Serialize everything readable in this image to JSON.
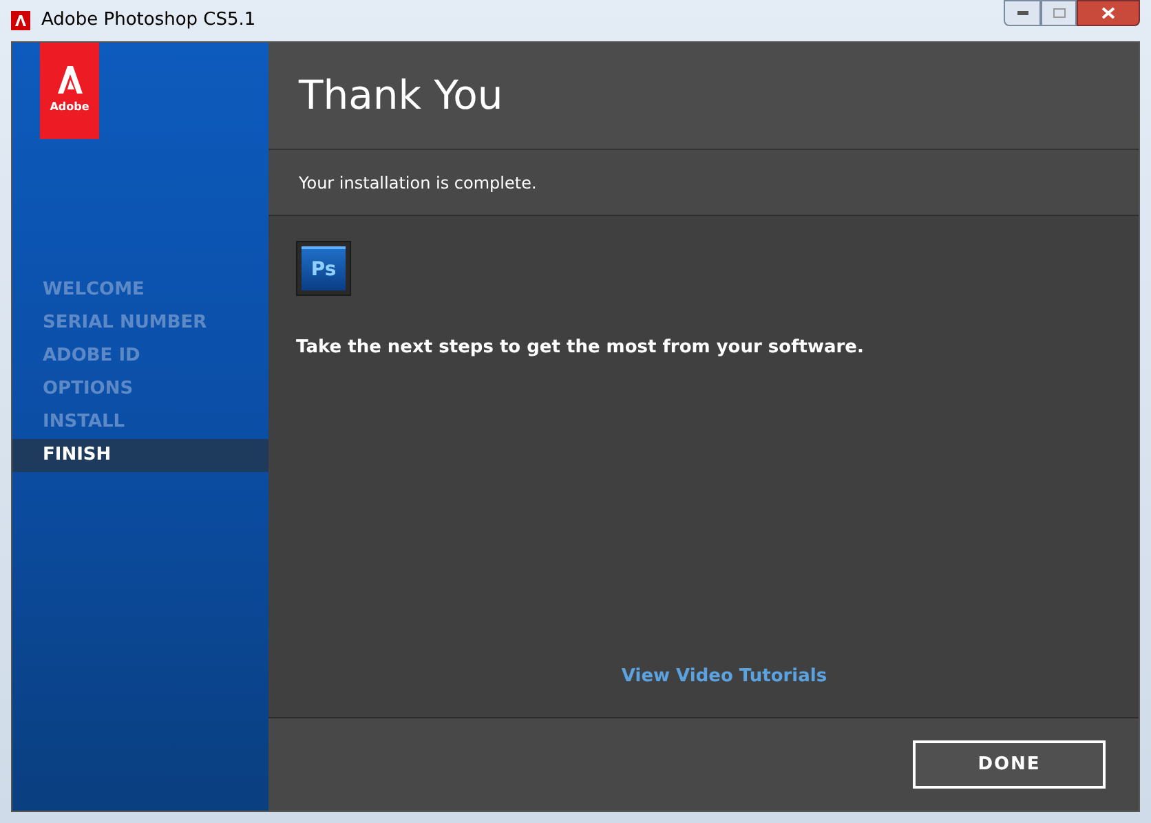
{
  "window": {
    "title": "Adobe Photoshop CS5.1"
  },
  "logo": {
    "text": "Adobe"
  },
  "steps": [
    {
      "label": "WELCOME",
      "selected": false
    },
    {
      "label": "SERIAL NUMBER",
      "selected": false
    },
    {
      "label": "ADOBE ID",
      "selected": false
    },
    {
      "label": "OPTIONS",
      "selected": false
    },
    {
      "label": "INSTALL",
      "selected": false
    },
    {
      "label": "FINISH",
      "selected": true
    }
  ],
  "header": {
    "title": "Thank You",
    "subtitle": "Your installation is complete."
  },
  "app_icon": {
    "text": "Ps"
  },
  "message": "Take the next steps to get the most from your software.",
  "link": "View Video Tutorials",
  "buttons": [
    {
      "label": "DONE"
    }
  ]
}
